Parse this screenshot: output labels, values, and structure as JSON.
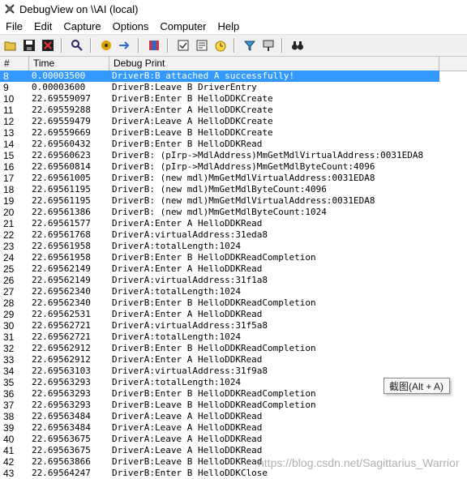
{
  "window": {
    "title": "DebugView on \\\\AI (local)"
  },
  "menu": [
    "File",
    "Edit",
    "Capture",
    "Options",
    "Computer",
    "Help"
  ],
  "toolbar_icons": [
    "open-icon",
    "save-icon",
    "clear-icon",
    "find-icon",
    "capture-icon",
    "autoscroll-icon",
    "bookmark-icon",
    "filter-icon",
    "highlight-icon",
    "clock-icon",
    "history-icon",
    "kernel-icon",
    "search-binoculars-icon"
  ],
  "columns": [
    "#",
    "Time",
    "Debug Print"
  ],
  "rows": [
    {
      "n": "8",
      "t": "0.00003500",
      "m": "DriverB:B attached A successfully!"
    },
    {
      "n": "9",
      "t": "0.00003600",
      "m": "DriverB:Leave B DriverEntry"
    },
    {
      "n": "10",
      "t": "22.69559097",
      "m": "DriverB:Enter B HelloDDKCreate"
    },
    {
      "n": "11",
      "t": "22.69559288",
      "m": "DriverA:Enter A HelloDDKCreate"
    },
    {
      "n": "12",
      "t": "22.69559479",
      "m": "DriverA:Leave A HelloDDKCreate"
    },
    {
      "n": "13",
      "t": "22.69559669",
      "m": "DriverB:Leave B HelloDDKCreate"
    },
    {
      "n": "14",
      "t": "22.69560432",
      "m": "DriverB:Enter B HelloDDKRead"
    },
    {
      "n": "15",
      "t": "22.69560623",
      "m": "DriverB: (pIrp->MdlAddress)MmGetMdlVirtualAddress:0031EDA8"
    },
    {
      "n": "16",
      "t": "22.69560814",
      "m": "DriverB: (pIrp->MdlAddress)MmGetMdlByteCount:4096"
    },
    {
      "n": "17",
      "t": "22.69561005",
      "m": "DriverB: (new mdl)MmGetMdlVirtualAddress:0031EDA8"
    },
    {
      "n": "18",
      "t": "22.69561195",
      "m": "DriverB: (new mdl)MmGetMdlByteCount:4096"
    },
    {
      "n": "19",
      "t": "22.69561195",
      "m": "DriverB: (new mdl)MmGetMdlVirtualAddress:0031EDA8"
    },
    {
      "n": "20",
      "t": "22.69561386",
      "m": "DriverB: (new mdl)MmGetMdlByteCount:1024"
    },
    {
      "n": "21",
      "t": "22.69561577",
      "m": "DriverA:Enter A HelloDDKRead"
    },
    {
      "n": "22",
      "t": "22.69561768",
      "m": "DriverA:virtualAddress:31eda8"
    },
    {
      "n": "23",
      "t": "22.69561958",
      "m": "DriverA:totalLength:1024"
    },
    {
      "n": "24",
      "t": "22.69561958",
      "m": "DriverB:Enter B HelloDDKReadCompletion"
    },
    {
      "n": "25",
      "t": "22.69562149",
      "m": "DriverA:Enter A HelloDDKRead"
    },
    {
      "n": "26",
      "t": "22.69562149",
      "m": "DriverA:virtualAddress:31f1a8"
    },
    {
      "n": "27",
      "t": "22.69562340",
      "m": "DriverA:totalLength:1024"
    },
    {
      "n": "28",
      "t": "22.69562340",
      "m": "DriverB:Enter B HelloDDKReadCompletion"
    },
    {
      "n": "29",
      "t": "22.69562531",
      "m": "DriverA:Enter A HelloDDKRead"
    },
    {
      "n": "30",
      "t": "22.69562721",
      "m": "DriverA:virtualAddress:31f5a8"
    },
    {
      "n": "31",
      "t": "22.69562721",
      "m": "DriverA:totalLength:1024"
    },
    {
      "n": "32",
      "t": "22.69562912",
      "m": "DriverB:Enter B HelloDDKReadCompletion"
    },
    {
      "n": "33",
      "t": "22.69562912",
      "m": "DriverA:Enter A HelloDDKRead"
    },
    {
      "n": "34",
      "t": "22.69563103",
      "m": "DriverA:virtualAddress:31f9a8"
    },
    {
      "n": "35",
      "t": "22.69563293",
      "m": "DriverA:totalLength:1024"
    },
    {
      "n": "36",
      "t": "22.69563293",
      "m": "DriverB:Enter B HelloDDKReadCompletion"
    },
    {
      "n": "37",
      "t": "22.69563293",
      "m": "DriverB:Leave B HelloDDKReadCompletion"
    },
    {
      "n": "38",
      "t": "22.69563484",
      "m": "DriverA:Leave A HelloDDKRead"
    },
    {
      "n": "39",
      "t": "22.69563484",
      "m": "DriverA:Leave A HelloDDKRead"
    },
    {
      "n": "40",
      "t": "22.69563675",
      "m": "DriverA:Leave A HelloDDKRead"
    },
    {
      "n": "41",
      "t": "22.69563675",
      "m": "DriverA:Leave A HelloDDKRead"
    },
    {
      "n": "42",
      "t": "22.69563866",
      "m": "DriverB:Leave B HelloDDKRead"
    },
    {
      "n": "43",
      "t": "22.69564247",
      "m": "DriverB:Enter B HelloDDKClose"
    }
  ],
  "tooltip": "截图(Alt + A)",
  "watermark": "https://blog.csdn.net/Sagittarius_Warrior",
  "colors": {
    "selection": "#3399ff"
  }
}
